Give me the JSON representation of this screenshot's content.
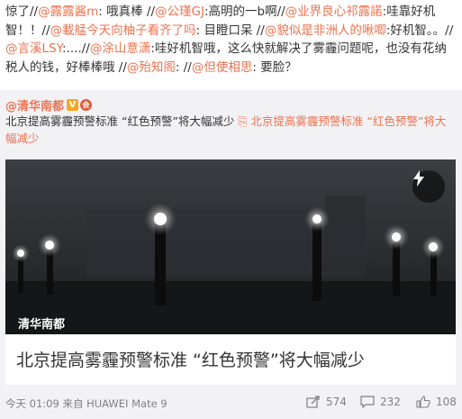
{
  "post": {
    "segments": [
      {
        "t": "惊了//",
        "link": false
      },
      {
        "t": "@露露酱m",
        "link": true
      },
      {
        "t": ": 哦真棒 //",
        "link": false
      },
      {
        "t": "@公瑾GJ",
        "link": true
      },
      {
        "t": ":高明的一b啊//",
        "link": false
      },
      {
        "t": "@业界良心祁露諾",
        "link": true
      },
      {
        "t": ":哇靠好机智！！//",
        "link": false
      },
      {
        "t": "@載艋今天向柚子看齐了吗",
        "link": true
      },
      {
        "t": ": 目瞪口呆 //",
        "link": false
      },
      {
        "t": "@貌似是非洲人的啾唧",
        "link": true
      },
      {
        "t": ":好机智。。//",
        "link": false
      },
      {
        "t": "@言溪LSY",
        "link": true
      },
      {
        "t": ":....//",
        "link": false
      },
      {
        "t": "@涂山意潇",
        "link": true
      },
      {
        "t": ":哇好机智哦，这么快就解决了雾霾问题呢，也没有花纳税人的钱，好棒棒哦 //",
        "link": false
      },
      {
        "t": "@殆知阁",
        "link": true
      },
      {
        "t": ": //",
        "link": false
      },
      {
        "t": "@但使相思",
        "link": true
      },
      {
        "t": ": 要脸？",
        "link": false
      }
    ]
  },
  "repost": {
    "author": "@清华南都",
    "badge_v": "V",
    "badge_medal": "会",
    "text_main": "北京提高雾霾预警标准 “红色预警”将大幅减少 ",
    "text_link": "北京提高雾霾预警标准 “红色预警”将大幅减少",
    "text_link_prefix_icon": "link-icon"
  },
  "card": {
    "source": "清华南都",
    "title": "北京提高雾霾预警标准 “红色预警”将大幅减少",
    "button_icon": "lightning-icon"
  },
  "footer": {
    "time": "今天 01:09",
    "from_label": "来自",
    "device": "HUAWEI Mate 9",
    "repost_count": "574",
    "comment_count": "232",
    "like_count": "108"
  },
  "colors": {
    "link": "#eb7350",
    "repost_bg": "#f2f2f5",
    "text": "#333333",
    "meta": "#808080"
  }
}
